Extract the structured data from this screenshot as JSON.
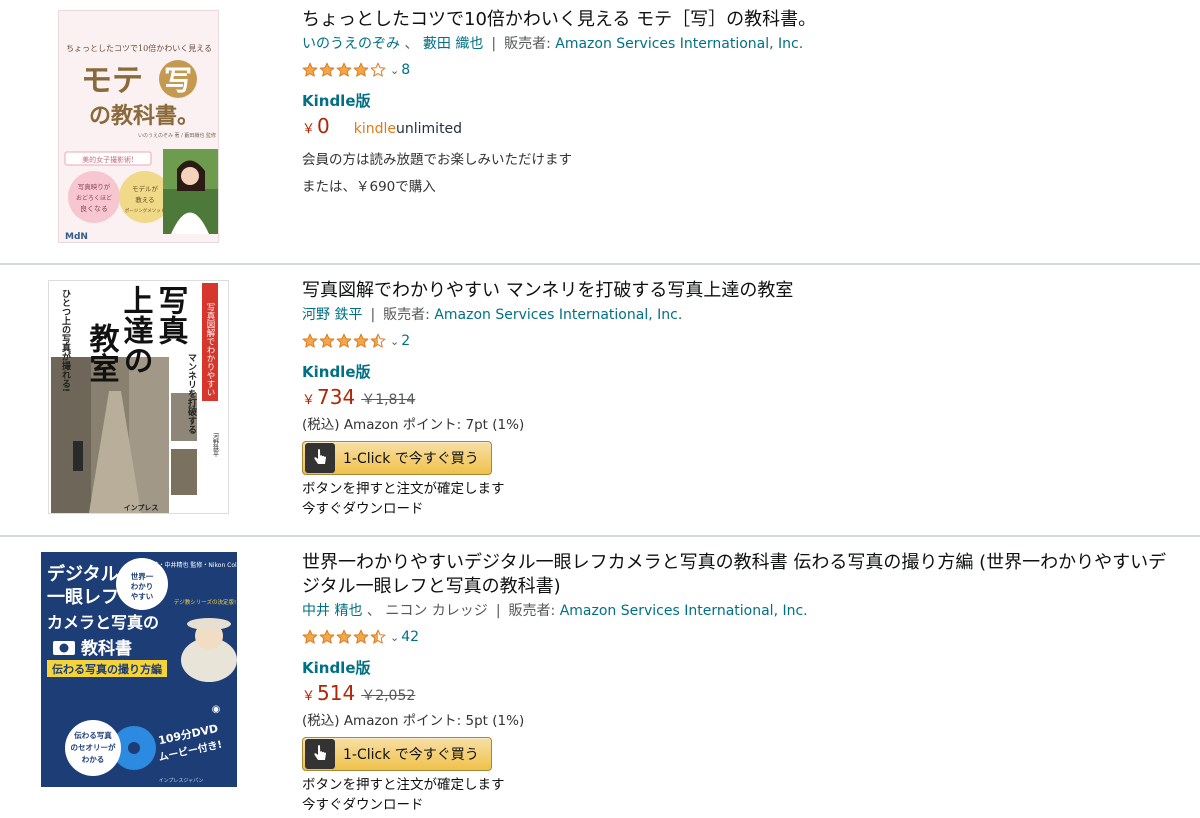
{
  "colors": {
    "link": "#007185",
    "price": "#b12704",
    "star": "#f3a847",
    "divider": "#d5d9d9"
  },
  "results": [
    {
      "title": "ちょっとしたコツで10倍かわいく見える モテ［写］の教科書。",
      "authors": [
        "いのうえのぞみ",
        "藪田 織也"
      ],
      "seller_label": "販売者:",
      "seller": "Amazon Services International, Inc.",
      "rating": 4.0,
      "rating_count": "8",
      "format": "Kindle版",
      "price_symbol": "￥",
      "price": "0",
      "kindle_unlimited": {
        "k": "kindle",
        "u": "unlimited"
      },
      "line1": "会員の方は読み放題でお楽しみいただけます",
      "line2": "または、￥690で購入",
      "cover": {
        "small_top": "ちょっとしたコツで10倍かわいく見える",
        "big_title": "モテ",
        "big_char": "写",
        "sub_title": "の教科書。",
        "credit": "いのうえのぞみ 著 / 藪田織也 監修",
        "tag": "美的女子撮影術!",
        "circle1": "写真映りがおどろくほど良くなる",
        "circle2": "モデルが教えるポージングメソッド",
        "publisher": "MdN"
      }
    },
    {
      "title": "写真図解でわかりやすい マンネリを打破する写真上達の教室",
      "authors": [
        "河野 鉄平"
      ],
      "seller_label": "販売者:",
      "seller": "Amazon Services International, Inc.",
      "rating": 4.5,
      "rating_count": "2",
      "format": "Kindle版",
      "price_symbol": "￥",
      "price": "734",
      "list_price": "￥1,814",
      "points_line": "(税込) Amazon ポイント: 7pt (1%)",
      "oneclick_label": "1-Click で今すぐ買う",
      "confirm_line": "ボタンを押すと注文が確定します",
      "download_line": "今すぐダウンロード",
      "cover": {
        "title_a": "写真",
        "title_b": "上達の",
        "title_c": "教室",
        "side_tag": "写真図解でわかりやすい",
        "side_sub": "マンネリを打破する",
        "left_text": "ひとつ上の写真が撮れる!",
        "author": "河野鉄平",
        "publisher": "インプレス"
      }
    },
    {
      "title": "世界一わかりやすいデジタル一眼レフカメラと写真の教科書 伝わる写真の撮り方編 (世界一わかりやすいデジタル一眼レフと写真の教科書)",
      "authors": [
        "中井 精也"
      ],
      "coauthor_plain": "ニコン カレッジ",
      "seller_label": "販売者:",
      "seller": "Amazon Services International, Inc.",
      "rating": 4.5,
      "rating_count": "42",
      "format": "Kindle版",
      "price_symbol": "￥",
      "price": "514",
      "list_price": "￥2,052",
      "points_line": "(税込) Amazon ポイント: 5pt (1%)",
      "oneclick_label": "1-Click で今すぐ買う",
      "confirm_line": "ボタンを押すと注文が確定します",
      "download_line": "今すぐダウンロード",
      "cover": {
        "line1": "デジタル",
        "line2": "一眼レフ",
        "line3": "カメラと写真の",
        "line4": "教科書",
        "band": "伝わる写真の撮り方編",
        "bubble": "世界一わかりやすい",
        "credit": "著・中井精也 監修・Nikon College",
        "series": "デジ教シリーズの決定版!",
        "disc_text": "伝わる写真のセオリーがわかる",
        "dvd": "109分DVDムービー付き!",
        "publisher": "インプレスジャパン"
      }
    }
  ]
}
